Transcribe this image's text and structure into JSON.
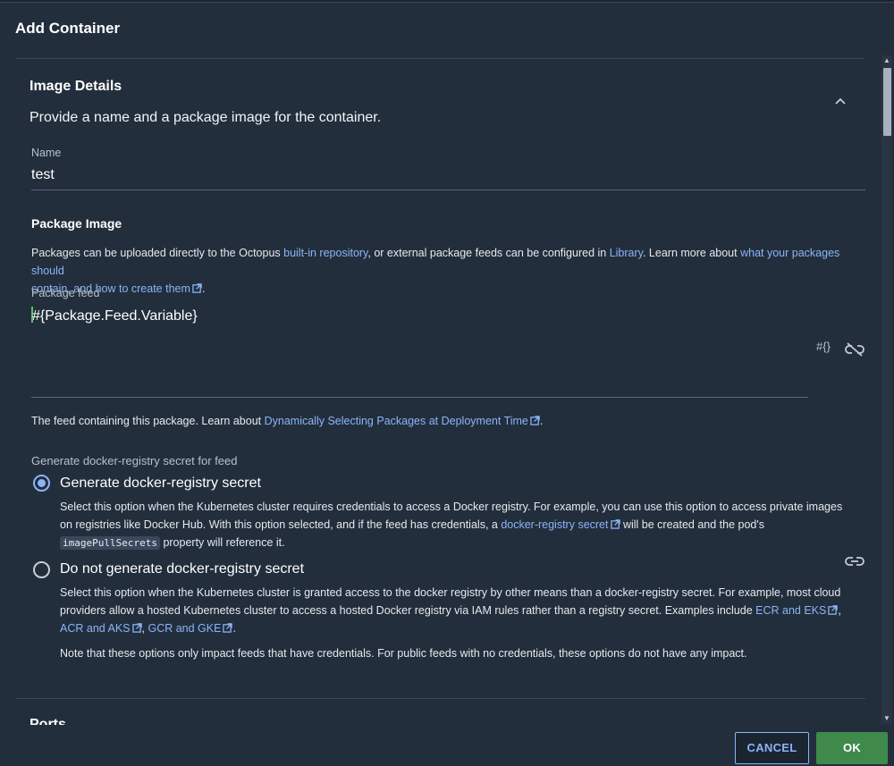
{
  "background_tabs": [
    "",
    "",
    "",
    "",
    ""
  ],
  "dialog": {
    "title": "Add Container"
  },
  "image_details": {
    "heading": "Image Details",
    "subtitle": "Provide a name and a package image for the container.",
    "name_label": "Name",
    "name_value": "test"
  },
  "package_image": {
    "heading": "Package Image",
    "desc_1": "Packages can be uploaded directly to the Octopus ",
    "link_builtin": "built-in repository",
    "desc_2": ", or external package feeds can be configured in ",
    "link_library": "Library",
    "desc_3": ". Learn more about ",
    "link_learn_a": "what your packages should",
    "link_learn_b": "contain, and how to create them",
    "desc_4": ".",
    "feed_label": "Package feed",
    "feed_value": "#{Package.Feed.Variable}",
    "variable_icon_text": "#{}",
    "feed_help_1": "The feed containing this package. Learn about ",
    "feed_help_link": "Dynamically Selecting Packages at Deployment Time",
    "feed_help_2": "."
  },
  "docker_secret": {
    "label": "Generate docker-registry secret for feed",
    "option1": {
      "label": "Generate docker-registry secret",
      "selected": true,
      "desc_1": "Select this option when the Kubernetes cluster requires credentials to access a Docker registry. For example, you can use this option to access private images",
      "desc_2": "on registries like Docker Hub. With this option selected, and if the feed has credentials, a ",
      "desc_link": "docker-registry secret",
      "desc_3": " will be created and the pod's",
      "code": "imagePullSecrets",
      "desc_4": " property will reference it."
    },
    "option2": {
      "label": "Do not generate docker-registry secret",
      "selected": false,
      "desc_1": "Select this option when the Kubernetes cluster is granted access to the docker registry by other means than a docker-registry secret. For example, most cloud",
      "desc_2": "providers allow a hosted Kubernetes cluster to access a hosted Docker registry via IAM rules rather than a registry secret. Examples include ",
      "link_ecr": "ECR and EKS",
      "sep": ",",
      "link_acr": "ACR and AKS",
      "sep2": ", ",
      "link_gcr": "GCR and GKE",
      "end": "."
    },
    "note": "Note that these options only impact feeds that have credentials. For public feeds with no credentials, these options do not have any impact."
  },
  "next_section": {
    "heading": "Ports"
  },
  "footer": {
    "cancel": "CANCEL",
    "ok": "OK"
  },
  "colors": {
    "background": "#232e3c",
    "link": "#8ab4f8",
    "ok_button": "#3f8a4a"
  }
}
